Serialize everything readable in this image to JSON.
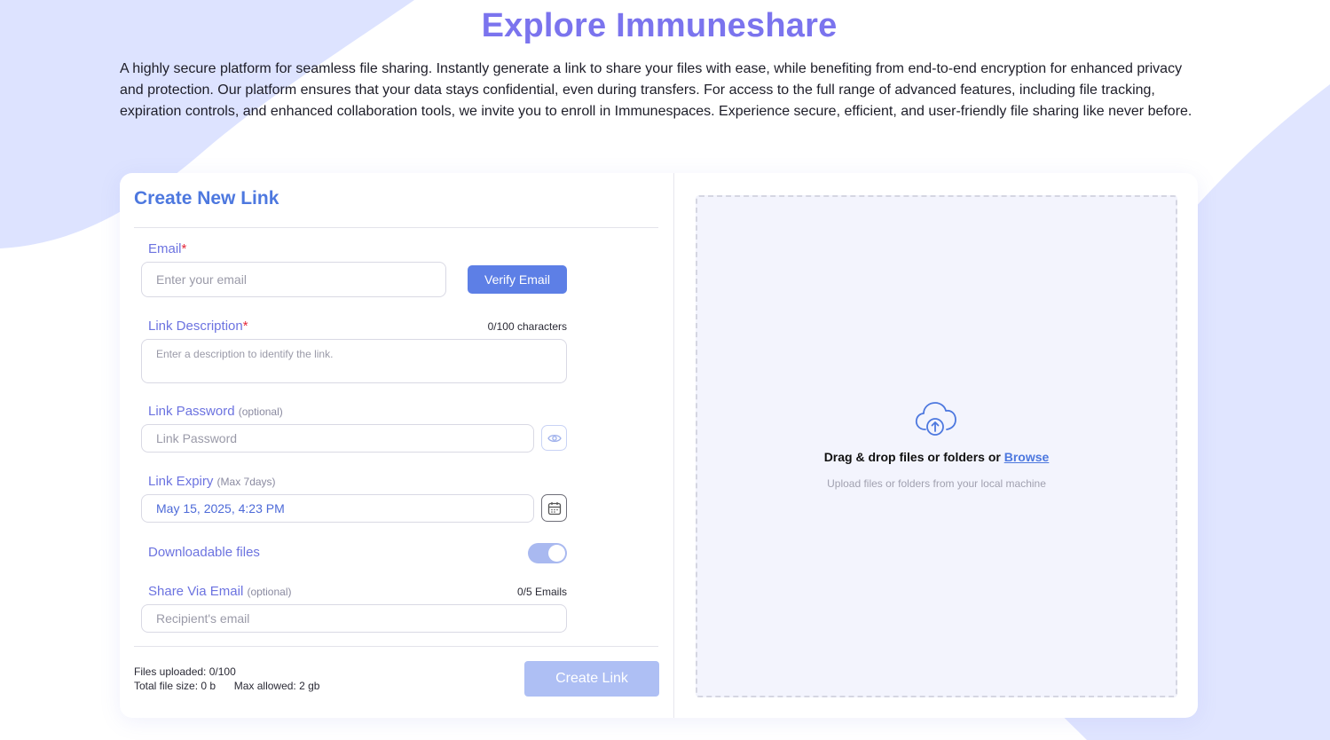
{
  "page": {
    "title": "Explore Immuneshare",
    "intro": "A highly secure platform for seamless file sharing. Instantly generate a link to share your files with ease, while benefiting from end-to-end encryption for enhanced privacy and protection. Our platform ensures that your data stays confidential, even during transfers. For access to the full range of advanced features, including file tracking, expiration controls, and enhanced collaboration tools, we invite you to enroll in Immunespaces. Experience secure, efficient, and user-friendly file sharing like never before."
  },
  "form": {
    "title": "Create New Link",
    "email": {
      "label": "Email",
      "required_mark": "*",
      "placeholder": "Enter your email",
      "verify_label": "Verify Email"
    },
    "description": {
      "label": "Link Description",
      "required_mark": "*",
      "counter": "0/100 characters",
      "placeholder": "Enter a description to identify the link."
    },
    "password": {
      "label": "Link Password",
      "optional": "(optional)",
      "placeholder": "Link Password"
    },
    "expiry": {
      "label": "Link Expiry",
      "hint": "(Max 7days)",
      "value": "May 15, 2025, 4:23 PM"
    },
    "downloadable": {
      "label": "Downloadable files",
      "enabled": true
    },
    "share_email": {
      "label": "Share Via Email",
      "optional": "(optional)",
      "counter": "0/5 Emails",
      "placeholder": "Recipient's email"
    },
    "footer": {
      "files_uploaded": "Files uploaded: 0/100",
      "total_size": "Total file size: 0 b",
      "max_allowed": "Max allowed: 2 gb",
      "create_label": "Create Link"
    }
  },
  "upload": {
    "drag_text": "Drag & drop files or folders or ",
    "browse_label": "Browse",
    "subtext": "Upload files or folders from your local machine",
    "icon": "cloud-upload-icon"
  },
  "colors": {
    "accent": "#7b74ee",
    "primary": "#5d7fe6",
    "label": "#6c73e0",
    "required": "#e5283a",
    "toggle_on": "#a9b9f0",
    "create_disabled": "#aebff4",
    "dropzone_bg": "#f3f4fd"
  }
}
